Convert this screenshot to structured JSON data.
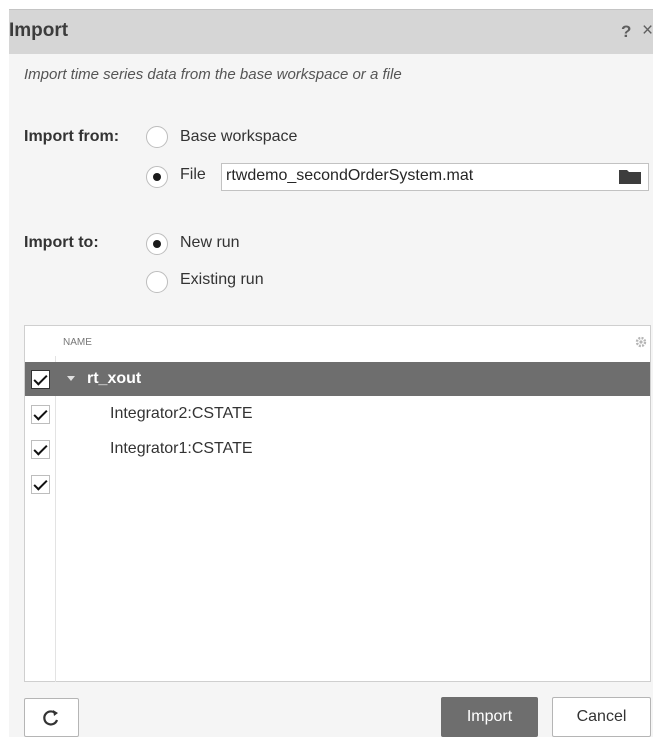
{
  "dialog": {
    "title": "Import",
    "help_label": "?",
    "close_label": "×",
    "subtitle": "Import time series data from the base workspace or a file"
  },
  "import_from": {
    "label": "Import from:",
    "options": [
      {
        "label": "Base workspace",
        "selected": false
      },
      {
        "label": "File",
        "selected": true
      }
    ],
    "file_value": "rtwdemo_secondOrderSystem.mat"
  },
  "import_to": {
    "label": "Import to:",
    "options": [
      {
        "label": "New run",
        "selected": true
      },
      {
        "label": "Existing run",
        "selected": false
      }
    ]
  },
  "table": {
    "header": "NAME",
    "rows": [
      {
        "label": "rt_xout",
        "checked": true,
        "expanded": true,
        "selected": true
      },
      {
        "label": "Integrator2:CSTATE",
        "checked": true
      },
      {
        "label": "Integrator1:CSTATE",
        "checked": true
      },
      {
        "label": "",
        "checked": true
      }
    ]
  },
  "buttons": {
    "import": "Import",
    "cancel": "Cancel"
  },
  "icons": {
    "folder": "folder-icon",
    "gear": "gear-icon",
    "refresh": "refresh-icon"
  }
}
